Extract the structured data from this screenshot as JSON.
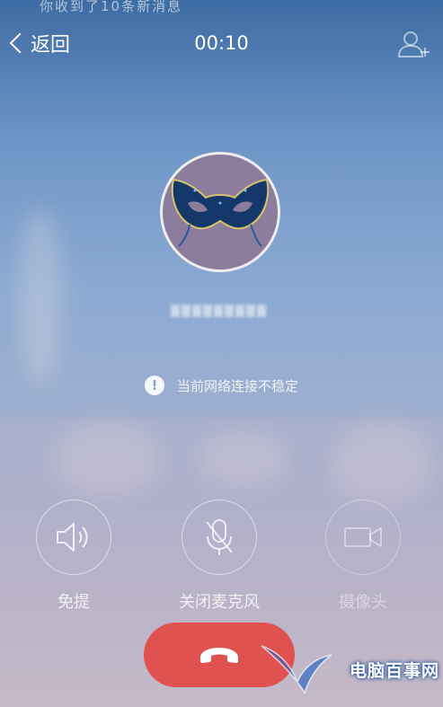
{
  "status_bar": {
    "notification_text": "你收到了10条新消息"
  },
  "header": {
    "back_label": "返回",
    "call_timer": "00:10"
  },
  "contact": {
    "avatar_icon": "masquerade-mask-icon"
  },
  "network_warning": {
    "text": "当前网络连接不稳定"
  },
  "controls": [
    {
      "label": "免提",
      "icon": "speaker-icon",
      "enabled": true
    },
    {
      "label": "关闭麦克风",
      "icon": "mic-off-icon",
      "enabled": true
    },
    {
      "label": "摄像头",
      "icon": "camera-icon",
      "enabled": false
    }
  ],
  "hangup": {
    "icon": "hangup-phone-icon",
    "color": "#e0524f"
  },
  "watermark": {
    "text": "电脑百事网"
  }
}
